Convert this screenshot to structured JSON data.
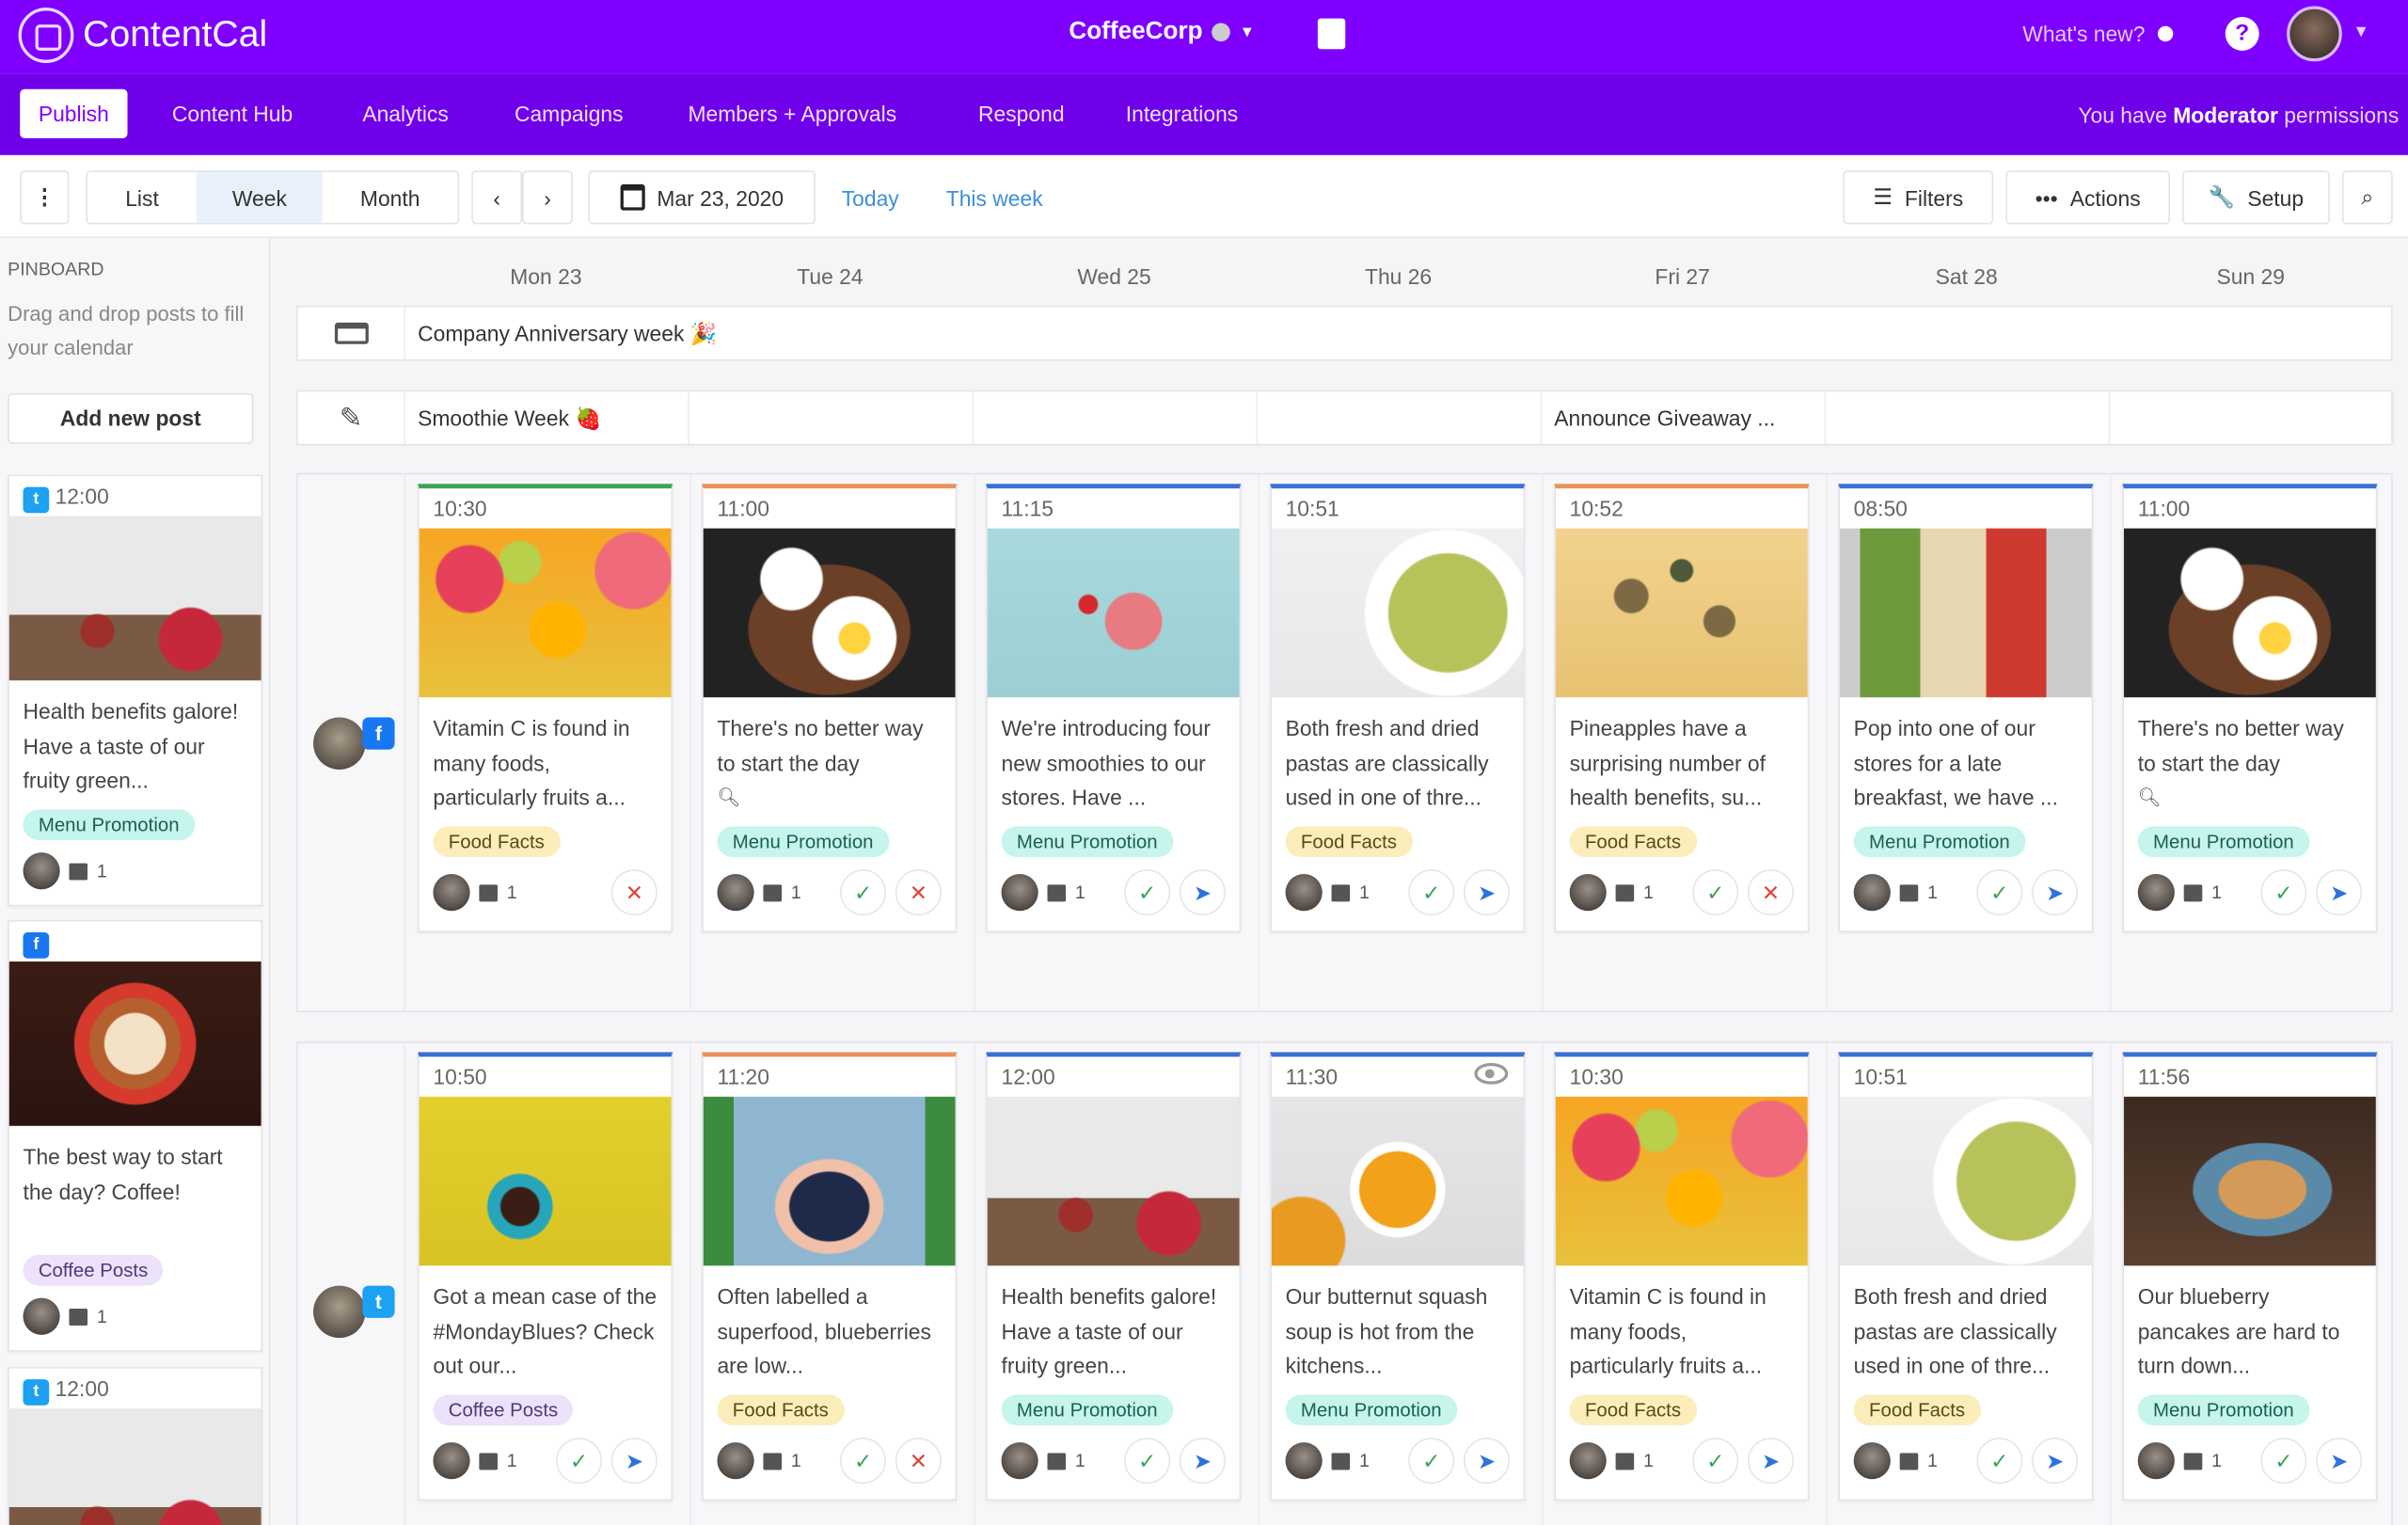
{
  "app": {
    "name": "ContentCal",
    "org": "CoffeeCorp",
    "whats_new": "What's new?",
    "help": "?"
  },
  "nav": {
    "items": [
      "Publish",
      "Content Hub",
      "Analytics",
      "Campaigns",
      "Members + Approvals",
      "Respond",
      "Integrations"
    ],
    "active": "Publish",
    "permissions_prefix": "You have",
    "permissions_role": "Moderator",
    "permissions_suffix": "permissions"
  },
  "toolbar": {
    "views": [
      "List",
      "Week",
      "Month"
    ],
    "selected_view": "Week",
    "date": "Mar 23, 2020",
    "today": "Today",
    "this_week": "This week",
    "filters": "Filters",
    "actions": "Actions",
    "setup": "Setup"
  },
  "pinboard": {
    "title": "PINBOARD",
    "description": "Drag and drop posts to fill your calendar",
    "add_button": "Add new post",
    "posts": [
      {
        "network": "twitter",
        "time": "12:00",
        "image": "tea",
        "text": "Health benefits galore! Have a taste of our fruity green...",
        "tag": "Menu Promotion",
        "tag_type": "menu",
        "count": "1"
      },
      {
        "network": "facebook",
        "time": "",
        "image": "latte",
        "text": "The best way to start the day? Coffee!",
        "tag": "Coffee Posts",
        "tag_type": "coffee",
        "count": "1"
      },
      {
        "network": "twitter",
        "time": "12:00",
        "image": "tea",
        "text": "",
        "tag": "",
        "tag_type": "",
        "count": ""
      }
    ]
  },
  "days": [
    "Mon 23",
    "Tue 24",
    "Wed 25",
    "Thu 26",
    "Fri 27",
    "Sat 28",
    "Sun 29"
  ],
  "bands": {
    "anniversary": "Company Anniversary week 🎉",
    "campaigns": [
      {
        "label": "Smoothie Week 🍓",
        "start": 0,
        "span": 1
      },
      {
        "label": "",
        "start": 1,
        "span": 1
      },
      {
        "label": "",
        "start": 2,
        "span": 1
      },
      {
        "label": "",
        "start": 3,
        "span": 1
      },
      {
        "label": "Announce Giveaway ...",
        "start": 4,
        "span": 1
      },
      {
        "label": "",
        "start": 5,
        "span": 1
      },
      {
        "label": "",
        "start": 6,
        "span": 1
      }
    ]
  },
  "colors": {
    "brand": "#7f00ff",
    "green": "#3aa457",
    "orange": "#e8925a",
    "blue": "#3b6fd6"
  },
  "rows": [
    {
      "network": "facebook",
      "cards": [
        {
          "time": "10:30",
          "accent": "green",
          "image": "citrus",
          "text": "Vitamin C is found in many foods, particularly fruits a...",
          "tag": "Food Facts",
          "tag_type": "food",
          "count": "1",
          "actions": [
            "reject"
          ]
        },
        {
          "time": "11:00",
          "accent": "orange",
          "image": "breakfast",
          "text": "There's no better way to start the day",
          "emoji": "search-icon",
          "tag": "Menu Promotion",
          "tag_type": "menu",
          "count": "1",
          "actions": [
            "approve",
            "reject"
          ]
        },
        {
          "time": "11:15",
          "accent": "blue",
          "image": "smoothie",
          "text": "We're introducing four new smoothies to our stores. Have ...",
          "tag": "Menu Promotion",
          "tag_type": "menu",
          "count": "1",
          "actions": [
            "approve",
            "send"
          ]
        },
        {
          "time": "10:51",
          "accent": "blue",
          "image": "pasta",
          "text": "Both fresh and dried pastas are classically used in one of thre...",
          "tag": "Food Facts",
          "tag_type": "food",
          "count": "1",
          "actions": [
            "approve",
            "send"
          ]
        },
        {
          "time": "10:52",
          "accent": "orange",
          "image": "pineapple",
          "text": "Pineapples have a surprising number of health benefits, su...",
          "tag": "Food Facts",
          "tag_type": "food",
          "count": "1",
          "actions": [
            "approve",
            "reject"
          ]
        },
        {
          "time": "08:50",
          "accent": "blue",
          "image": "toast",
          "text": "Pop into one of our stores for a late breakfast, we have ...",
          "tag": "Menu Promotion",
          "tag_type": "menu",
          "count": "1",
          "actions": [
            "approve",
            "send"
          ]
        },
        {
          "time": "11:00",
          "accent": "blue",
          "image": "breakfast",
          "text": "There's no better way to start the day",
          "emoji": "search-icon",
          "tag": "Menu Promotion",
          "tag_type": "menu",
          "count": "1",
          "actions": [
            "approve",
            "send"
          ]
        }
      ]
    },
    {
      "network": "twitter",
      "cards": [
        {
          "time": "10:50",
          "accent": "blue",
          "image": "coffee",
          "text": "Got a mean case of the #MondayBlues? Check out our...",
          "tag": "Coffee Posts",
          "tag_type": "coffee",
          "count": "1",
          "actions": [
            "approve",
            "send"
          ]
        },
        {
          "time": "11:20",
          "accent": "orange",
          "image": "blueberries",
          "text": "Often labelled a superfood, blueberries are low...",
          "tag": "Food Facts",
          "tag_type": "food",
          "count": "1",
          "actions": [
            "approve",
            "reject"
          ]
        },
        {
          "time": "12:00",
          "accent": "blue",
          "image": "tea",
          "text": "Health benefits galore! Have a taste of our fruity green...",
          "tag": "Menu Promotion",
          "tag_type": "menu",
          "count": "1",
          "actions": [
            "approve",
            "send"
          ]
        },
        {
          "time": "11:30",
          "accent": "blue",
          "image": "soup",
          "preview": true,
          "text": "Our butternut squash soup is hot from the kitchens...",
          "tag": "Menu Promotion",
          "tag_type": "menu",
          "count": "1",
          "actions": [
            "approve",
            "send"
          ]
        },
        {
          "time": "10:30",
          "accent": "blue",
          "image": "citrus",
          "text": "Vitamin C is found in many foods, particularly fruits a...",
          "tag": "Food Facts",
          "tag_type": "food",
          "count": "1",
          "actions": [
            "approve",
            "send"
          ]
        },
        {
          "time": "10:51",
          "accent": "blue",
          "image": "pasta",
          "text": "Both fresh and dried pastas are classically used in one of thre...",
          "tag": "Food Facts",
          "tag_type": "food",
          "count": "1",
          "actions": [
            "approve",
            "send"
          ]
        },
        {
          "time": "11:56",
          "accent": "blue",
          "image": "pancakes",
          "text": "Our blueberry pancakes are hard to turn down...",
          "tag": "Menu Promotion",
          "tag_type": "menu",
          "count": "1",
          "actions": [
            "approve",
            "send"
          ]
        }
      ]
    }
  ]
}
